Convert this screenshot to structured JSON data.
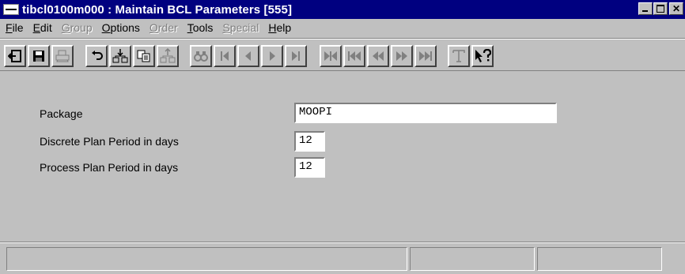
{
  "window": {
    "title": "tibcl0100m000 : Maintain BCL Parameters [555]",
    "controls": [
      "minimize",
      "maximize",
      "close"
    ]
  },
  "menu": [
    {
      "label": "File",
      "enabled": true
    },
    {
      "label": "Edit",
      "enabled": true
    },
    {
      "label": "Group",
      "enabled": false
    },
    {
      "label": "Options",
      "enabled": true
    },
    {
      "label": "Order",
      "enabled": false
    },
    {
      "label": "Tools",
      "enabled": true
    },
    {
      "label": "Special",
      "enabled": false
    },
    {
      "label": "Help",
      "enabled": true
    }
  ],
  "toolbar": {
    "buttons": [
      {
        "name": "exit-icon",
        "enabled": true
      },
      {
        "name": "save-icon",
        "enabled": true
      },
      {
        "name": "print-icon",
        "enabled": false
      },
      {
        "name": "undo-icon",
        "enabled": true
      },
      {
        "name": "insert-record-icon",
        "enabled": true
      },
      {
        "name": "copy-record-icon",
        "enabled": true
      },
      {
        "name": "delete-record-icon",
        "enabled": false
      },
      {
        "name": "find-icon",
        "enabled": false
      },
      {
        "name": "first-record-icon",
        "enabled": false
      },
      {
        "name": "previous-record-icon",
        "enabled": false
      },
      {
        "name": "next-record-icon",
        "enabled": false
      },
      {
        "name": "last-record-icon",
        "enabled": false
      },
      {
        "name": "first-set-icon",
        "enabled": false
      },
      {
        "name": "previous-set-icon",
        "enabled": false
      },
      {
        "name": "rewind-icon",
        "enabled": false
      },
      {
        "name": "fast-forward-icon",
        "enabled": false
      },
      {
        "name": "last-set-icon",
        "enabled": false
      },
      {
        "name": "text-icon",
        "enabled": false
      },
      {
        "name": "context-help-icon",
        "enabled": true
      }
    ]
  },
  "form": {
    "package_label": "Package",
    "package_value": "MOOPI",
    "discrete_label": "Discrete Plan Period in days",
    "discrete_value": "12",
    "process_label": "Process Plan Period in days",
    "process_value": "12"
  },
  "status": [
    "",
    "",
    ""
  ],
  "colors": {
    "titlebar": "#000080",
    "face": "#c0c0c0",
    "disabled": "#808080"
  }
}
